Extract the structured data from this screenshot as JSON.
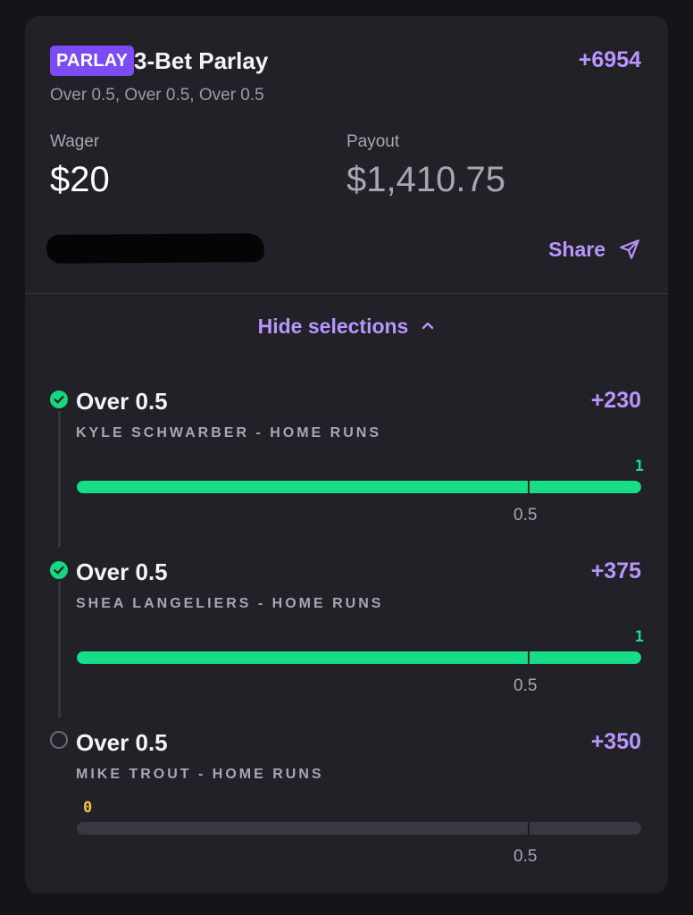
{
  "header": {
    "badge": "PARLAY",
    "title": "3-Bet Parlay",
    "odds": "+6954",
    "subtitle": "Over 0.5, Over 0.5, Over 0.5"
  },
  "wager": {
    "label": "Wager",
    "value": "$20"
  },
  "payout": {
    "label": "Payout",
    "value": "$1,410.75"
  },
  "share_label": "Share",
  "toggle_label": "Hide selections",
  "colors": {
    "accent": "#b895ff",
    "badge": "#7b4cf3",
    "won": "#16dd86",
    "pending": "#f2c34e",
    "card": "#222127"
  },
  "legs": [
    {
      "status": "won",
      "pick": "Over 0.5",
      "odds": "+230",
      "player": "KYLE SCHWARBER - HOME RUNS",
      "actual": "1",
      "threshold": "0.5",
      "progress": 1.0
    },
    {
      "status": "won",
      "pick": "Over 0.5",
      "odds": "+375",
      "player": "SHEA LANGELIERS - HOME RUNS",
      "actual": "1",
      "threshold": "0.5",
      "progress": 1.0
    },
    {
      "status": "open",
      "pick": "Over 0.5",
      "odds": "+350",
      "player": "MIKE TROUT - HOME RUNS",
      "actual": "0",
      "threshold": "0.5",
      "progress": 0.0
    }
  ]
}
